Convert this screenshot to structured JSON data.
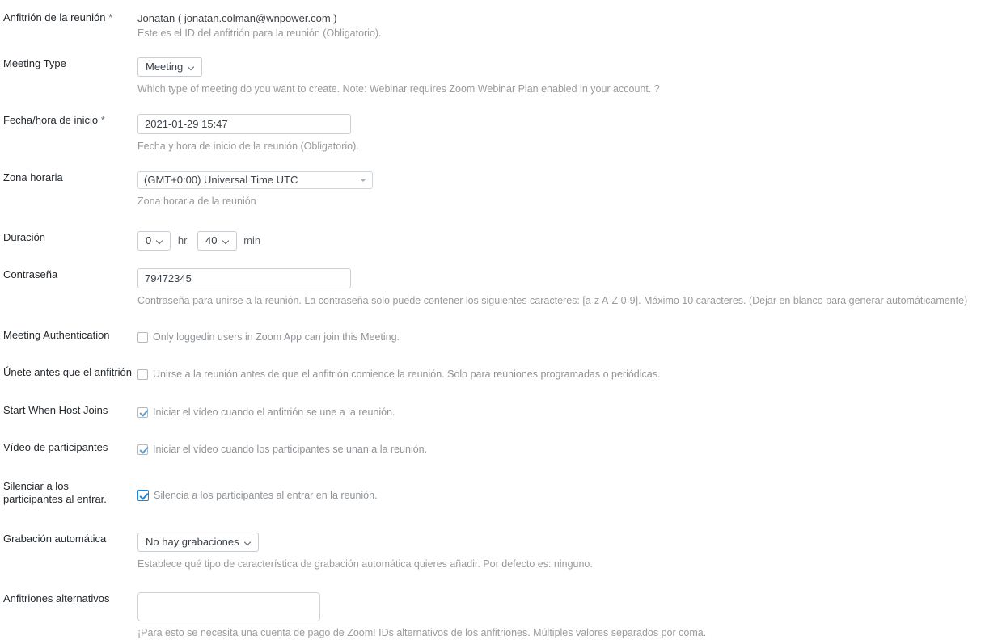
{
  "form": {
    "rows": [
      {
        "id": "meeting-host",
        "label": "Anfitrión de la reunión",
        "required": true,
        "value": "Jonatan ( jonatan.colman@wnpower.com )",
        "help": "Este es el ID del anfitrión para la reunión (Obligatorio)."
      },
      {
        "id": "meeting-type",
        "label": "Meeting Type",
        "required": false,
        "value": "Meeting",
        "help": "Which type of meeting do you want to create. Note: Webinar requires Zoom Webinar Plan enabled in your account. ?"
      },
      {
        "id": "start-datetime",
        "label": "Fecha/hora de inicio",
        "required": true,
        "value": "2021-01-29 15:47",
        "placeholder": "",
        "help": "Fecha y hora de inicio de la reunión (Obligatorio)."
      },
      {
        "id": "timezone",
        "label": "Zona horaria",
        "required": false,
        "value": "(GMT+0:00) Universal Time UTC",
        "help": "Zona horaria de la reunión"
      },
      {
        "id": "duration",
        "label": "Duración",
        "required": false,
        "hours": "0",
        "hours_unit": "hr",
        "minutes": "40",
        "minutes_unit": "min",
        "help": ""
      },
      {
        "id": "password",
        "label": "Contraseña",
        "required": false,
        "value": "79472345",
        "placeholder": "",
        "help": "Contraseña para unirse a la reunión. La contraseña solo puede contener los siguientes caracteres: [a-z A-Z 0-9]. Máximo 10 caracteres. (Dejar en blanco para generar automáticamente)"
      },
      {
        "id": "meeting-authentication",
        "label": "Meeting Authentication",
        "required": false,
        "checked": false,
        "focused": false,
        "checkbox_label": "Only loggedin users in Zoom App can join this Meeting."
      },
      {
        "id": "join-before-host",
        "label": "Únete antes que el anfitrión",
        "required": false,
        "checked": false,
        "focused": false,
        "checkbox_label": "Unirse a la reunión antes de que el anfitrión comience la reunión. Solo para reuniones programadas o periódicas."
      },
      {
        "id": "start-when-host-joins",
        "label": "Start When Host Joins",
        "required": false,
        "checked": true,
        "focused": false,
        "checkbox_label": "Iniciar el vídeo cuando el anfitrión se une a la reunión."
      },
      {
        "id": "participants-video",
        "label": "Vídeo de participantes",
        "required": false,
        "checked": true,
        "focused": false,
        "checkbox_label": "Iniciar el vídeo cuando los participantes se unan a la reunión."
      },
      {
        "id": "mute-on-entry",
        "label": "Silenciar a los participantes al entrar.",
        "required": false,
        "checked": true,
        "focused": true,
        "checkbox_label": "Silencia a los participantes al entrar en la reunión."
      },
      {
        "id": "auto-recording",
        "label": "Grabación automática",
        "required": false,
        "value": "No hay grabaciones",
        "help": "Establece qué tipo de característica de grabación automática quieres añadir. Por defecto es: ninguno."
      },
      {
        "id": "alternative-hosts",
        "label": "Anfitriones alternativos",
        "required": false,
        "value": "",
        "placeholder": "",
        "help": "¡Para esto se necesita una cuenta de pago de Zoom! IDs alternativos de los anfitriones. Múltiples valores separados por coma."
      }
    ]
  },
  "colors": {
    "label_text": "#23282d",
    "help_text": "#9a9a9a",
    "input_border": "#ccd0d4",
    "checkbox_check": "#5b9dd9",
    "checkbox_focus": "#1a84d8",
    "page_background": "#ffffff"
  }
}
